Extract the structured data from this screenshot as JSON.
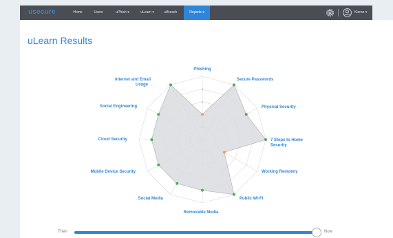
{
  "topbar": {
    "logo": "usecure",
    "nav": [
      "Home",
      "Users",
      "uPhish ▾",
      "uLearn ▾",
      "uBreach",
      "Reports ▾"
    ],
    "active_index": 5,
    "user_label": "Kieran ▾",
    "icons": {
      "settings": "gear-icon",
      "account": "user-circle-icon"
    }
  },
  "page": {
    "title": "uLearn Results"
  },
  "chart_data": {
    "type": "radar",
    "title": "",
    "categories": [
      "Phishing",
      "Secure Passwords",
      "Physical Security",
      "7 Steps to Home Security",
      "Working Remotely",
      "Public Wi-Fi",
      "Removable Media",
      "Social Media",
      "Mobile Device Security",
      "Cloud Security",
      "Social Engineering",
      "Internet and Email Usage"
    ],
    "series": [
      {
        "values": [
          40,
          100,
          80,
          100,
          40,
          100,
          80,
          80,
          80,
          80,
          80,
          100
        ]
      }
    ],
    "radial_ticks": [
      "0",
      "2",
      "4",
      "6",
      "8"
    ],
    "rlim": [
      0,
      100
    ],
    "colors": {
      "fill": "#dadcdf",
      "stroke": "#b7bbc0",
      "high": "#45b04a",
      "low": "#f4a13a",
      "label": "#2f86d8",
      "grid": "#d6d9dd"
    }
  },
  "slider": {
    "left_label": "Then",
    "right_label": "Now",
    "value": 1.0
  }
}
